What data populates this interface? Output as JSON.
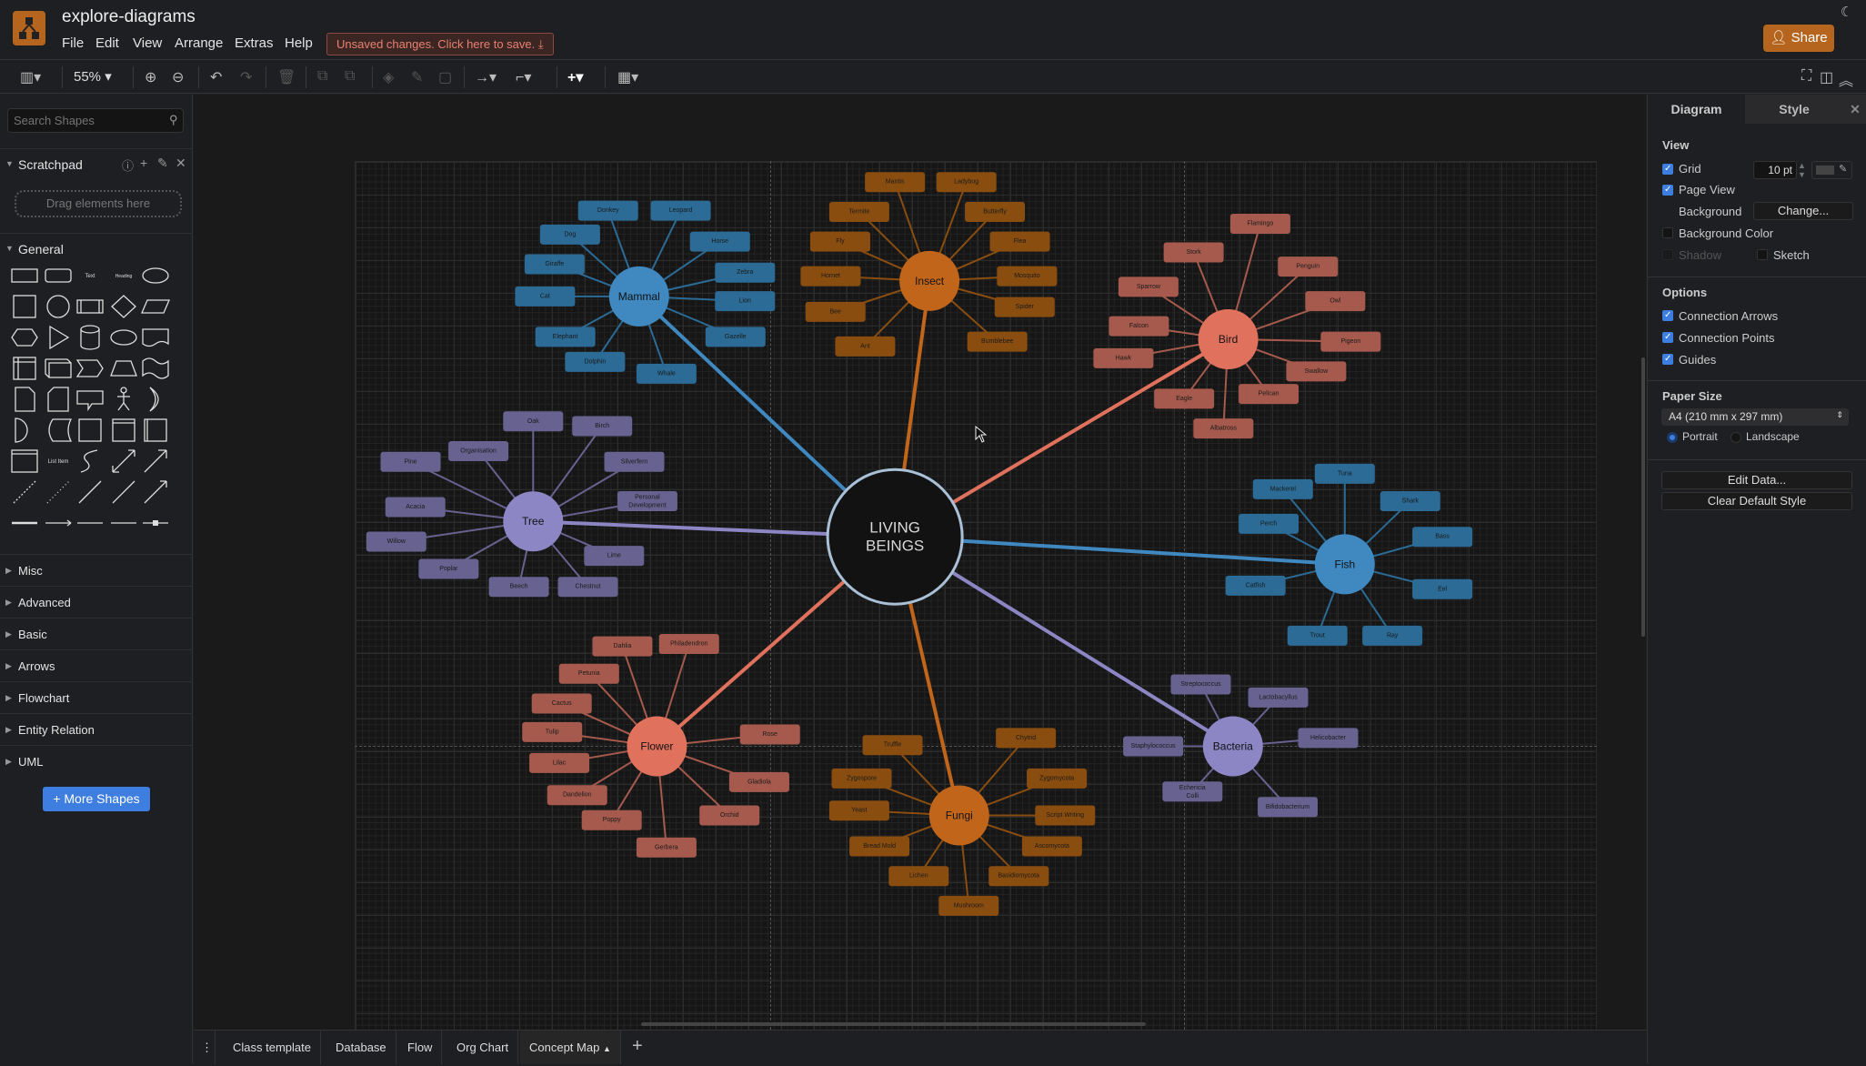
{
  "app": {
    "title": "explore-diagrams",
    "menu": [
      "File",
      "Edit",
      "View",
      "Arrange",
      "Extras",
      "Help"
    ],
    "unsaved": "Unsaved changes. Click here to save.",
    "share": "Share",
    "accent": "#b5651d"
  },
  "toolbar": {
    "zoom": "55%",
    "icons": [
      "format-panel-icon",
      "zoom-in-icon",
      "zoom-out-icon",
      "undo-icon",
      "redo-icon",
      "delete-icon",
      "to-front-icon",
      "to-back-icon",
      "fill-color-icon",
      "line-color-icon",
      "shadow-icon",
      "connection-icon",
      "waypoints-icon",
      "insert-icon",
      "table-icon",
      "fullscreen-icon",
      "toggle-panel-icon",
      "collapse-icon"
    ]
  },
  "sidebar": {
    "search_placeholder": "Search Shapes",
    "scratchpad": "Scratchpad",
    "drag_hint": "Drag elements here",
    "general": "General",
    "shape_text": "Text",
    "shape_heading": "Heading",
    "shape_list_item": "List Item",
    "categories": [
      "Misc",
      "Advanced",
      "Basic",
      "Arrows",
      "Flowchart",
      "Entity Relation",
      "UML"
    ],
    "more_shapes": "+ More Shapes"
  },
  "diagram": {
    "center": {
      "label_line1": "LIVING",
      "label_line2": "BEINGS"
    },
    "hubs": [
      {
        "label": "Mammal",
        "hub_color": "#3f88c0",
        "leaf_color": "#2b6b95",
        "leaves": [
          "Donkey",
          "Leopard",
          "Dog",
          "Horse",
          "Giraffe",
          "Zebra",
          "Cat",
          "Lion",
          "Elephant",
          "Gazelle",
          "Dolphin",
          "Whale"
        ]
      },
      {
        "label": "Insect",
        "hub_color": "#c0651a",
        "leaf_color": "#8a4d10",
        "leaves": [
          "Mantis",
          "Ladybug",
          "Termite",
          "Butterfly",
          "Fly",
          "Flea",
          "Hornet",
          "Mosquito",
          "Bee",
          "Spider",
          "Ant",
          "Bumblebee"
        ]
      },
      {
        "label": "Bird",
        "hub_color": "#e0725d",
        "leaf_color": "#a65a4d",
        "leaves": [
          "Flamingo",
          "Stork",
          "Penguin",
          "Sparrow",
          "Owl",
          "Falcon",
          "Pigeon",
          "Hawk",
          "Swallow",
          "Pelican",
          "Eagle",
          "Albatross"
        ]
      },
      {
        "label": "Tree",
        "hub_color": "#8c86c4",
        "leaf_color": "#67628f",
        "leaves": [
          "Oak",
          "Birch",
          "Organisation",
          "Pine",
          "Silverfern",
          "Personal Development",
          "Acacia",
          "Willow",
          "Lime",
          "Poplar",
          "Beech",
          "Chestnut"
        ]
      },
      {
        "label": "Fish",
        "hub_color": "#3f88c0",
        "leaf_color": "#2b6b95",
        "leaves": [
          "Tuna",
          "Mackerel",
          "Shark",
          "Perch",
          "Bass",
          "Catfish",
          "Eel",
          "Trout",
          "Ray"
        ]
      },
      {
        "label": "Flower",
        "hub_color": "#e0725d",
        "leaf_color": "#a65a4d",
        "leaves": [
          "Dahlia",
          "Philadendron",
          "Petunia",
          "Cactus",
          "Tulip",
          "Rose",
          "Lilac",
          "Gladiola",
          "Dandelion",
          "Orchid",
          "Poppy",
          "Gerbera"
        ]
      },
      {
        "label": "Fungi",
        "hub_color": "#c0651a",
        "leaf_color": "#8a4d10",
        "leaves": [
          "Truffle",
          "Chytrid",
          "Zygospore",
          "Zygomycota",
          "Yeast",
          "Script Writing",
          "Bread Mold",
          "Ascomycota",
          "Lichen",
          "Basidiomycota",
          "Mushroom"
        ]
      },
      {
        "label": "Bacteria",
        "hub_color": "#8c86c4",
        "leaf_color": "#67628f",
        "leaves": [
          "Streptococcus",
          "Lactobacyllus",
          "Staphylococcus",
          "Helicobacter",
          "Echericia Colli",
          "Bifidobacterium"
        ]
      }
    ]
  },
  "panel": {
    "tabs": [
      "Diagram",
      "Style"
    ],
    "view": "View",
    "grid": "Grid",
    "grid_size": "10 pt",
    "page_view": "Page View",
    "background": "Background",
    "change": "Change...",
    "background_color": "Background Color",
    "shadow": "Shadow",
    "sketch": "Sketch",
    "options": "Options",
    "connection_arrows": "Connection Arrows",
    "connection_points": "Connection Points",
    "guides": "Guides",
    "paper_size": "Paper Size",
    "paper_value": "A4 (210 mm x 297 mm)",
    "portrait": "Portrait",
    "landscape": "Landscape",
    "edit_data": "Edit Data...",
    "clear_style": "Clear Default Style",
    "checks": {
      "grid": true,
      "page_view": true,
      "background_color": false,
      "shadow": false,
      "sketch": false,
      "connection_arrows": true,
      "connection_points": true,
      "guides": true
    },
    "orientation": "Portrait"
  },
  "pages": {
    "tabs": [
      "Class template",
      "Database",
      "Flow",
      "Org Chart",
      "Concept Map"
    ],
    "active": "Concept Map"
  }
}
